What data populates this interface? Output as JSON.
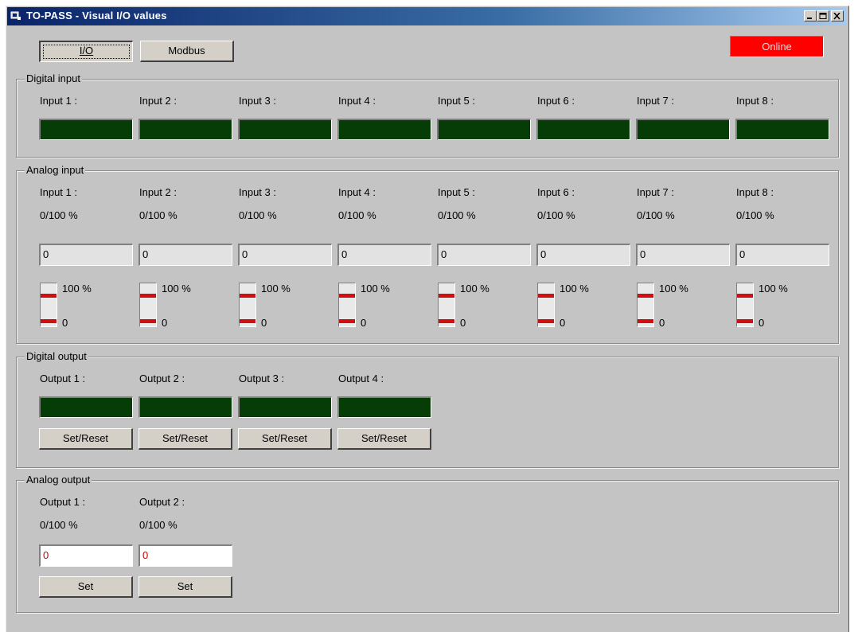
{
  "window": {
    "title": "TO-PASS - Visual I/O values"
  },
  "toolbar": {
    "io_label": "I/O",
    "modbus_label": "Modbus",
    "status_label": "Online",
    "status_color": "#ff0000"
  },
  "digital_input": {
    "title": "Digital input",
    "inputs": [
      {
        "label": "Input 1 :"
      },
      {
        "label": "Input 2 :"
      },
      {
        "label": "Input 3 :"
      },
      {
        "label": "Input 4 :"
      },
      {
        "label": "Input 5 :"
      },
      {
        "label": "Input 6 :"
      },
      {
        "label": "Input 7 :"
      },
      {
        "label": "Input 8 :"
      }
    ],
    "led_color": "#063c06"
  },
  "analog_input": {
    "title": "Analog input",
    "inputs": [
      {
        "label": "Input 1 :",
        "range": "0/100 %",
        "value": "0",
        "max_label": "100 %",
        "min_label": "0"
      },
      {
        "label": "Input 2 :",
        "range": "0/100 %",
        "value": "0",
        "max_label": "100 %",
        "min_label": "0"
      },
      {
        "label": "Input 3 :",
        "range": "0/100 %",
        "value": "0",
        "max_label": "100 %",
        "min_label": "0"
      },
      {
        "label": "Input 4 :",
        "range": "0/100 %",
        "value": "0",
        "max_label": "100 %",
        "min_label": "0"
      },
      {
        "label": "Input 5 :",
        "range": "0/100 %",
        "value": "0",
        "max_label": "100 %",
        "min_label": "0"
      },
      {
        "label": "Input 6 :",
        "range": "0/100 %",
        "value": "0",
        "max_label": "100 %",
        "min_label": "0"
      },
      {
        "label": "Input 7 :",
        "range": "0/100 %",
        "value": "0",
        "max_label": "100 %",
        "min_label": "0"
      },
      {
        "label": "Input 8 :",
        "range": "0/100 %",
        "value": "0",
        "max_label": "100 %",
        "min_label": "0"
      }
    ]
  },
  "digital_output": {
    "title": "Digital output",
    "outputs": [
      {
        "label": "Output 1 :",
        "button": "Set/Reset"
      },
      {
        "label": "Output 2 :",
        "button": "Set/Reset"
      },
      {
        "label": "Output 3 :",
        "button": "Set/Reset"
      },
      {
        "label": "Output 4 :",
        "button": "Set/Reset"
      }
    ]
  },
  "analog_output": {
    "title": "Analog output",
    "outputs": [
      {
        "label": "Output 1 :",
        "range": "0/100 %",
        "value": "0",
        "button": "Set"
      },
      {
        "label": "Output 2 :",
        "range": "0/100 %",
        "value": "0",
        "button": "Set"
      }
    ]
  },
  "icons": {
    "app": "window-app-icon",
    "minimize": "minimize-icon",
    "maximize": "maximize-icon",
    "close": "close-icon"
  }
}
